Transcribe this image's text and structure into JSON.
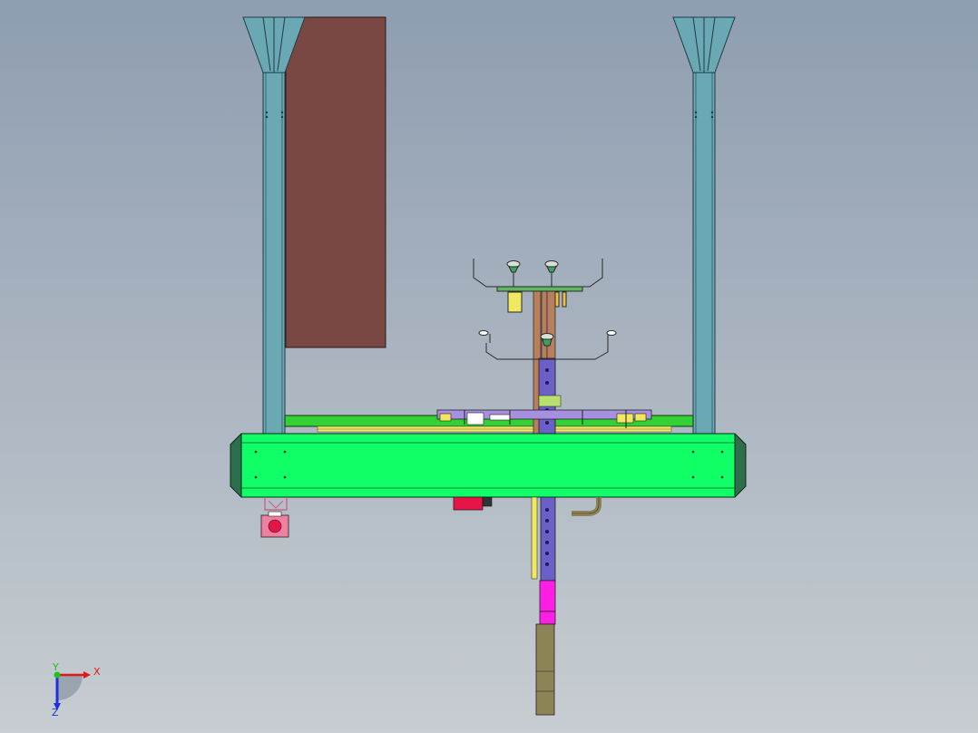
{
  "viewport": {
    "background_top": "#8e9db0",
    "background_bottom": "#c7cdd1"
  },
  "colors": {
    "column": "#6aa8b4",
    "column_edge": "#1f3c44",
    "panel": "#7a4842",
    "base_frame": "#10ff66",
    "base_end_cap": "#2d6e4c",
    "rail": "#33d133",
    "mast_purple": "#6a60c8",
    "mast_copper": "#b87e60",
    "magenta_block": "#ff1ee4",
    "mast_lower": "#8d8355",
    "yellow_part": "#f0e860",
    "red_part": "#e81448",
    "gripper_frame": "#2a2a2a",
    "triad_x": "#e01818",
    "triad_y": "#20c020",
    "triad_z": "#2030e0"
  },
  "triad": {
    "x_label": "X",
    "y_label": "Y",
    "z_label": "Z"
  }
}
